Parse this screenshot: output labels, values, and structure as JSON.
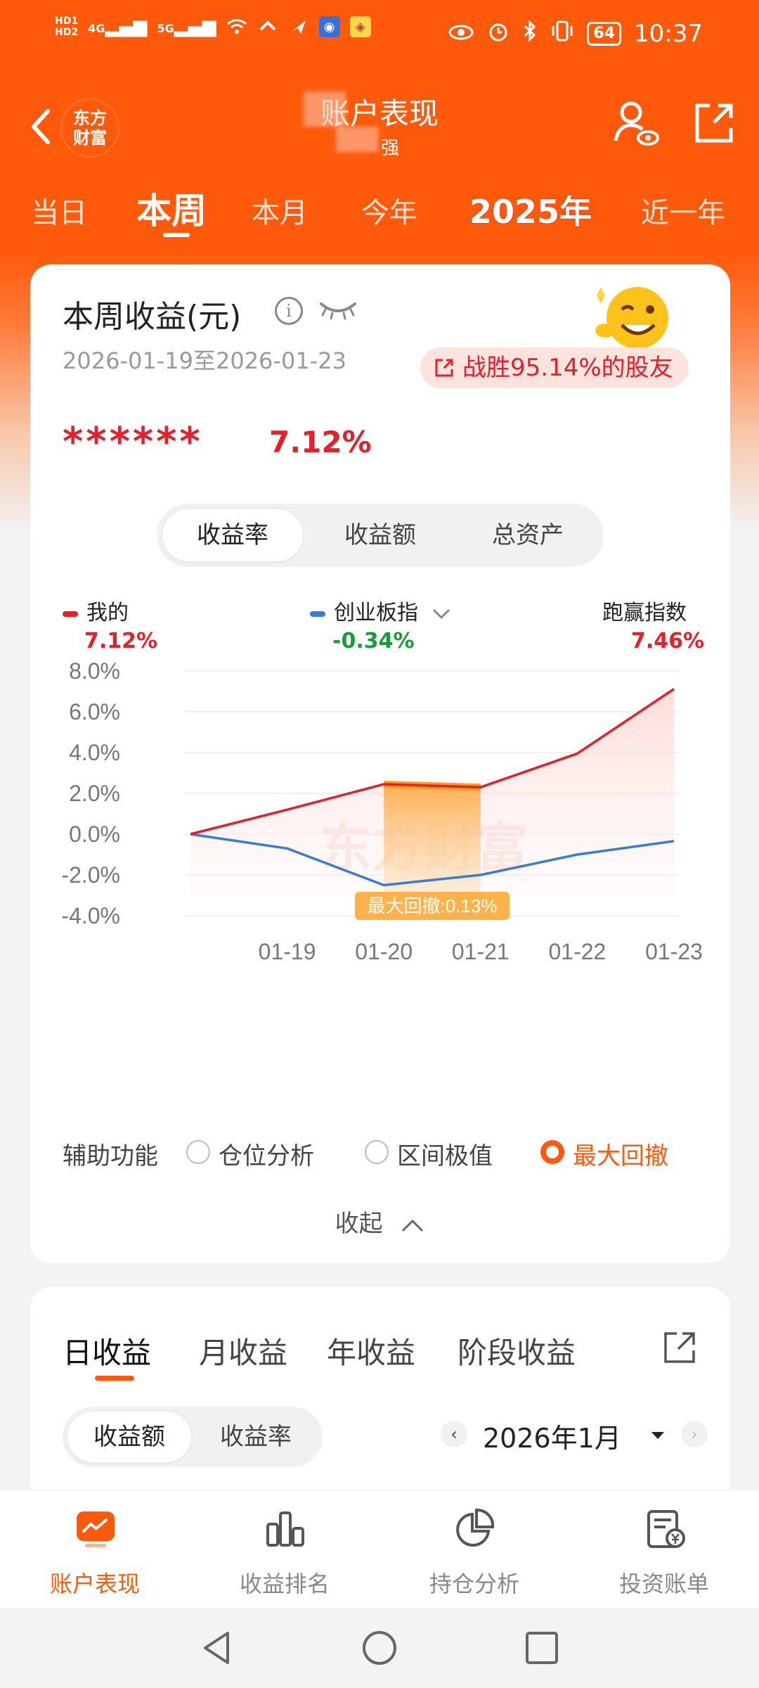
{
  "status_bar": {
    "network_left": [
      "HD1",
      "HD2",
      "4G",
      "5G"
    ],
    "battery": "64",
    "time": "10:37"
  },
  "header": {
    "logo_text": "东方财富",
    "title": "账户表现",
    "subtitle": "强"
  },
  "period_tabs": [
    {
      "label": "当日"
    },
    {
      "label": "本周",
      "active": true
    },
    {
      "label": "本月"
    },
    {
      "label": "今年"
    },
    {
      "label": "2025年"
    },
    {
      "label": "近一年"
    }
  ],
  "summary": {
    "title": "本周收益(元)",
    "date_range": "2026-01-19至2026-01-23",
    "beat_text": "战胜95.14%的股友",
    "hidden_amount": "******",
    "return_pct": "7.12%"
  },
  "metric_tabs": [
    {
      "label": "收益率",
      "active": true
    },
    {
      "label": "收益额"
    },
    {
      "label": "总资产"
    }
  ],
  "legend": {
    "mine": {
      "label": "我的",
      "value": "7.12%",
      "color": "#e4202c"
    },
    "index": {
      "label": "创业板指",
      "value": "-0.34%",
      "color": "#3a7bd5",
      "value_color": "#1a9a3a"
    },
    "beat_index": {
      "label": "跑赢指数",
      "value": "7.46%",
      "color": "#e4202c"
    }
  },
  "chart_data": {
    "type": "line",
    "x": [
      "",
      "01-19",
      "01-20",
      "01-21",
      "01-22",
      "01-23"
    ],
    "ylim": [
      -4.0,
      8.0
    ],
    "yticks": [
      "8.0%",
      "6.0%",
      "4.0%",
      "2.0%",
      "0.0%",
      "-2.0%",
      "-4.0%"
    ],
    "series": [
      {
        "name": "我的",
        "values": [
          0.0,
          1.2,
          2.45,
          2.3,
          3.95,
          7.12
        ],
        "color": "#e4202c"
      },
      {
        "name": "创业板指",
        "values": [
          0.0,
          -0.7,
          -2.5,
          -2.0,
          -1.0,
          -0.34
        ],
        "color": "#3a7bd5"
      }
    ],
    "annotation": {
      "text": "最大回撤:0.13%",
      "from_index": 2,
      "to_index": 3
    },
    "watermark": "东方财富",
    "grid": true
  },
  "aux": {
    "label": "辅助功能",
    "options": [
      {
        "label": "仓位分析",
        "checked": false
      },
      {
        "label": "区间极值",
        "checked": false
      },
      {
        "label": "最大回撤",
        "checked": true
      }
    ],
    "collapse": "收起"
  },
  "income_tabs": [
    {
      "label": "日收益",
      "active": true
    },
    {
      "label": "月收益"
    },
    {
      "label": "年收益"
    },
    {
      "label": "阶段收益"
    }
  ],
  "income_metric_tabs": [
    {
      "label": "收益额",
      "active": true
    },
    {
      "label": "收益率"
    }
  ],
  "month_selector": {
    "value": "2026年1月"
  },
  "bottom_nav": [
    {
      "label": "账户表现",
      "active": true
    },
    {
      "label": "收益排名"
    },
    {
      "label": "持仓分析"
    },
    {
      "label": "投资账单"
    }
  ],
  "colors": {
    "brand": "#ff5a0b",
    "up": "#e4202c",
    "down": "#1a9a3a"
  }
}
